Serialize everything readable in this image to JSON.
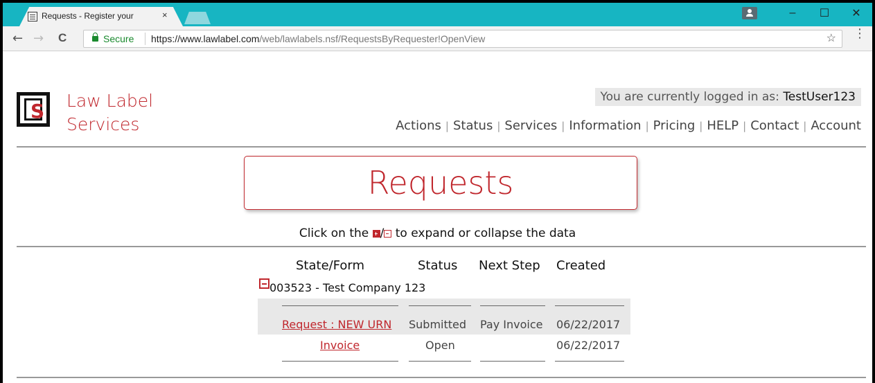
{
  "browser": {
    "tab_title": "Requests - Register your",
    "tab_close": "×",
    "window_minimize": "–",
    "window_maximize": "☐",
    "window_close": "✕",
    "back": "←",
    "forward": "→",
    "reload": "C",
    "secure_label": "Secure",
    "url_host": "https://www.lawlabel.com",
    "url_path": "/web/lawlabels.nsf/RequestsByRequester!OpenView",
    "star": "☆",
    "menu": "⋮"
  },
  "site": {
    "brand_line1": "Law Label",
    "brand_line2": "Services",
    "logo_letter": "S",
    "login_prefix": "You are currently logged in as: ",
    "login_user": "TestUser123",
    "nav": [
      "Actions",
      "Status",
      "Services",
      "Information",
      "Pricing",
      "HELP",
      "Contact",
      "Account"
    ],
    "nav_separator": "|"
  },
  "content": {
    "title": "Requests",
    "hint_before": "Click on the ",
    "hint_slash": "/",
    "hint_after": " to expand or collapse the data",
    "columns": [
      "State/Form",
      "Status",
      "Next Step",
      "Created"
    ],
    "group_label": "003523 - Test Company 123",
    "rows": [
      {
        "form": "Request : NEW URN",
        "status": "Submitted",
        "next_step": "Pay Invoice",
        "created": "06/22/2017"
      },
      {
        "form": "Invoice",
        "status": "Open",
        "next_step": "",
        "created": "06/22/2017"
      }
    ]
  }
}
